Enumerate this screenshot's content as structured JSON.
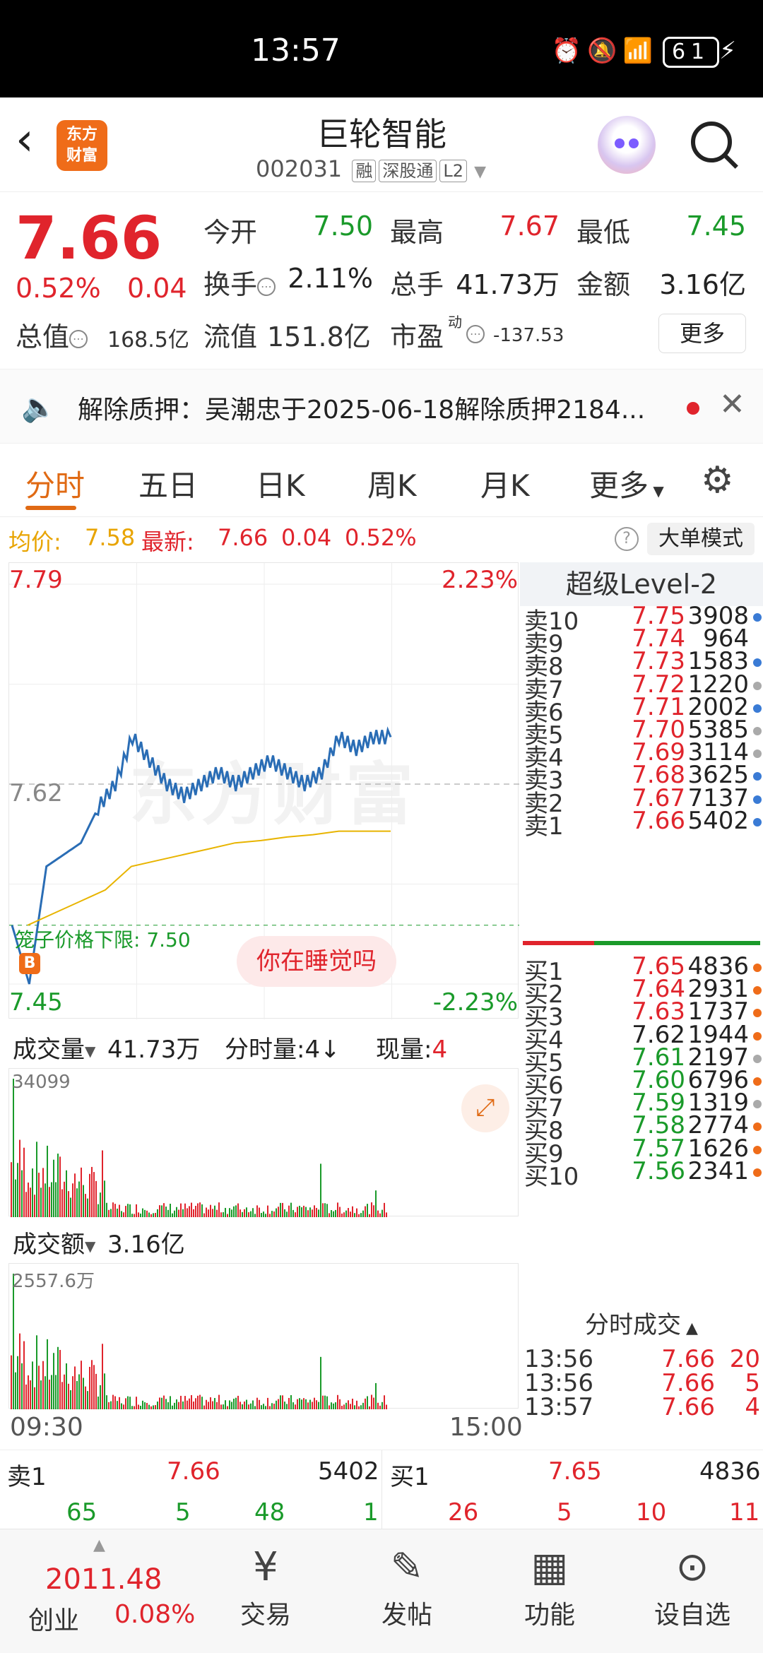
{
  "status": {
    "time": "13:57",
    "battery": "61"
  },
  "header": {
    "name": "巨轮智能",
    "code": "002031",
    "tags": [
      "融",
      "深股通",
      "L2"
    ],
    "logo_line1": "东方",
    "logo_line2": "财富"
  },
  "quote": {
    "price": "7.66",
    "change_pct": "0.52%",
    "change_abs": "0.04",
    "open_label": "今开",
    "open": "7.50",
    "high_label": "最高",
    "high": "7.67",
    "low_label": "最低",
    "low": "7.45",
    "turnover_label": "换手",
    "turnover": "2.11%",
    "volume_label": "总手",
    "volume": "41.73万",
    "amount_label": "金额",
    "amount": "3.16亿",
    "mktcap_label": "总值",
    "mktcap": "168.5亿",
    "float_label": "流值",
    "float": "151.8亿",
    "pe_label": "市盈",
    "pe_sup": "动",
    "pe": "-137.53",
    "more": "更多"
  },
  "notice": {
    "text": "解除质押：吴潮忠于2025-06-18解除质押2184..."
  },
  "tabs": {
    "t1": "分时",
    "t2": "五日",
    "t3": "日K",
    "t4": "周K",
    "t5": "月K",
    "t6": "更多"
  },
  "infoline": {
    "avg_label": "均价:",
    "avg": "7.58",
    "latest_label": "最新:",
    "latest": "7.66",
    "chg": "0.04",
    "pct": "0.52%",
    "mode": "大单模式"
  },
  "chart": {
    "top_price": "7.79",
    "top_pct": "2.23%",
    "bottom_price": "7.45",
    "bottom_pct": "-2.23%",
    "mid_price": "7.62",
    "limit_label": "笼子价格下限: 7.50",
    "pill": "你在睡觉吗",
    "watermark": "东方财富",
    "b_badge": "B"
  },
  "chart_data": {
    "type": "line",
    "x": [
      "09:30",
      "15:00"
    ],
    "ylim": [
      7.45,
      7.79
    ],
    "ref_price": 7.62,
    "series": [
      {
        "values": [
          7.5,
          7.45,
          7.55,
          7.56,
          7.57,
          7.6,
          7.62,
          7.66,
          7.64,
          7.62,
          7.61,
          7.62,
          7.63,
          7.62,
          7.63,
          7.64,
          7.63,
          7.62,
          7.63,
          7.66,
          7.65,
          7.66,
          7.66
        ]
      },
      {
        "values": [
          7.5,
          7.51,
          7.52,
          7.53,
          7.55,
          7.555,
          7.56,
          7.565,
          7.57,
          7.572,
          7.575,
          7.577,
          7.58,
          7.58,
          7.58
        ]
      }
    ]
  },
  "volume": {
    "label": "成交量",
    "total": "41.73万",
    "sub1": "分时量:4↓",
    "sub2_label": "现量:",
    "sub2": "4",
    "peak": "34099"
  },
  "amount": {
    "label": "成交额",
    "total": "3.16亿",
    "peak": "2557.6万"
  },
  "time_axis": {
    "start": "09:30",
    "end": "15:00"
  },
  "book": {
    "title": "超级Level-2",
    "asks": [
      {
        "lbl": "卖10",
        "p": "7.75",
        "v": "3908",
        "d": "#3a7bd5"
      },
      {
        "lbl": "卖9",
        "p": "7.74",
        "v": "964",
        "d": ""
      },
      {
        "lbl": "卖8",
        "p": "7.73",
        "v": "1583",
        "d": "#3a7bd5"
      },
      {
        "lbl": "卖7",
        "p": "7.72",
        "v": "1220",
        "d": "#aaaaaa"
      },
      {
        "lbl": "卖6",
        "p": "7.71",
        "v": "2002",
        "d": "#3a7bd5"
      },
      {
        "lbl": "卖5",
        "p": "7.70",
        "v": "5385",
        "d": "#aaaaaa"
      },
      {
        "lbl": "卖4",
        "p": "7.69",
        "v": "3114",
        "d": "#aaaaaa"
      },
      {
        "lbl": "卖3",
        "p": "7.68",
        "v": "3625",
        "d": "#3a7bd5"
      },
      {
        "lbl": "卖2",
        "p": "7.67",
        "v": "7137",
        "d": "#3a7bd5"
      },
      {
        "lbl": "卖1",
        "p": "7.66",
        "v": "5402",
        "d": "#3a7bd5"
      }
    ],
    "bids": [
      {
        "lbl": "买1",
        "p": "7.65",
        "v": "4836",
        "d": "#ef6c19"
      },
      {
        "lbl": "买2",
        "p": "7.64",
        "v": "2931",
        "d": "#ef6c19"
      },
      {
        "lbl": "买3",
        "p": "7.63",
        "v": "1737",
        "d": "#ef6c19"
      },
      {
        "lbl": "买4",
        "p": "7.62",
        "v": "1944",
        "d": "#ef6c19"
      },
      {
        "lbl": "买5",
        "p": "7.61",
        "v": "2197",
        "d": "#aaaaaa"
      },
      {
        "lbl": "买6",
        "p": "7.60",
        "v": "6796",
        "d": "#ef6c19"
      },
      {
        "lbl": "买7",
        "p": "7.59",
        "v": "1319",
        "d": "#aaaaaa"
      },
      {
        "lbl": "买8",
        "p": "7.58",
        "v": "2774",
        "d": "#ef6c19"
      },
      {
        "lbl": "买9",
        "p": "7.57",
        "v": "1626",
        "d": "#ef6c19"
      },
      {
        "lbl": "买10",
        "p": "7.56",
        "v": "2341",
        "d": "#ef6c19"
      }
    ],
    "ticks_title": "分时成交",
    "ticks": [
      {
        "t": "13:56",
        "p": "7.66",
        "v": "20"
      },
      {
        "t": "13:56",
        "p": "7.66",
        "v": "5"
      },
      {
        "t": "13:57",
        "p": "7.66",
        "v": "4"
      }
    ]
  },
  "bottom_quote": {
    "ask_lbl": "卖1",
    "ask_p": "7.66",
    "ask_v": "5402",
    "bid_lbl": "买1",
    "bid_p": "7.65",
    "bid_v": "4836",
    "ask_row": [
      "65",
      "5",
      "48",
      "1"
    ],
    "bid_row": [
      "26",
      "5",
      "10",
      "11"
    ]
  },
  "nav": {
    "index_value": "2011.48",
    "index_name": "创业",
    "index_pct": "0.08%",
    "trade": "交易",
    "post": "发帖",
    "func": "功能",
    "watch": "设自选"
  },
  "colors": {
    "up": "#e0242c",
    "down": "#1a9a2a",
    "accent": "#e06a14",
    "line": "#2a6db5",
    "avg": "#e8b400"
  }
}
